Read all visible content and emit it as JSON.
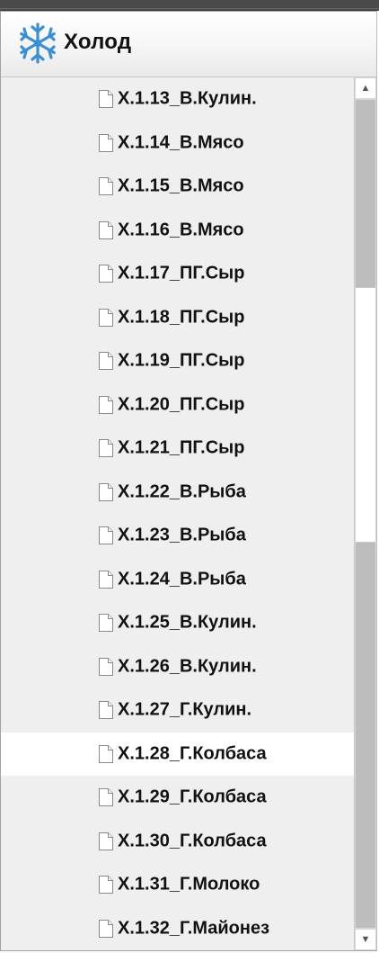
{
  "header": {
    "title": "Холод",
    "icon": "snowflake-icon",
    "icon_color": "#3a8fd6"
  },
  "list": {
    "items": [
      {
        "label": "Х.1.13_В.Кулин."
      },
      {
        "label": "Х.1.14_В.Мясо"
      },
      {
        "label": "Х.1.15_В.Мясо"
      },
      {
        "label": "Х.1.16_В.Мясо"
      },
      {
        "label": "Х.1.17_ПГ.Сыр"
      },
      {
        "label": "Х.1.18_ПГ.Сыр"
      },
      {
        "label": "Х.1.19_ПГ.Сыр"
      },
      {
        "label": "Х.1.20_ПГ.Сыр"
      },
      {
        "label": "Х.1.21_ПГ.Сыр"
      },
      {
        "label": "Х.1.22_В.Рыба"
      },
      {
        "label": "Х.1.23_В.Рыба"
      },
      {
        "label": "Х.1.24_В.Рыба"
      },
      {
        "label": "Х.1.25_В.Кулин."
      },
      {
        "label": "Х.1.26_В.Кулин."
      },
      {
        "label": "Х.1.27_Г.Кулин."
      },
      {
        "label": "Х.1.28_Г.Колбаса",
        "selected": true
      },
      {
        "label": "Х.1.29_Г.Колбаса"
      },
      {
        "label": "Х.1.30_Г.Колбаса"
      },
      {
        "label": "Х.1.31_Г.Молоко"
      },
      {
        "label": "Х.1.32_Г.Майонез"
      }
    ],
    "item_icon": "document-icon"
  },
  "scrollbar": {
    "up_arrow": "▲",
    "down_arrow": "▼"
  }
}
